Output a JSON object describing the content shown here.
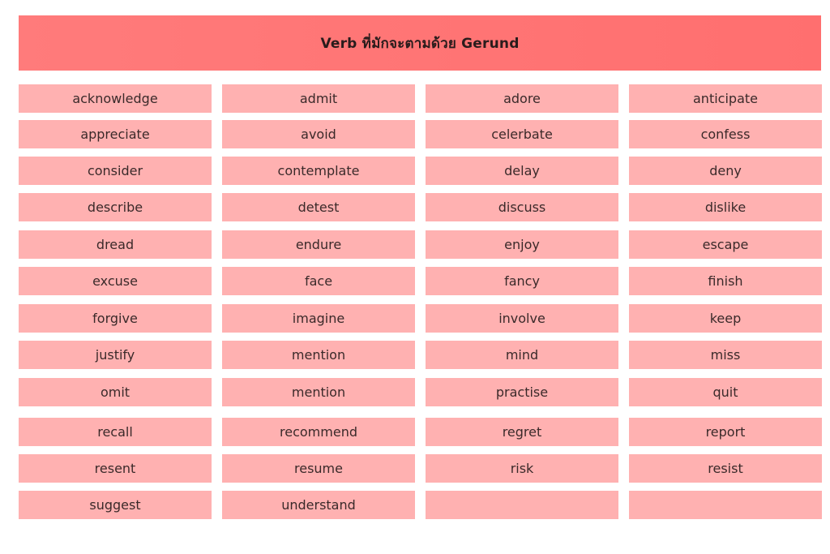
{
  "title": "Verb ที่มักจะตามด้วย Gerund",
  "rows": [
    [
      "acknowledge",
      "admit",
      "adore",
      "anticipate"
    ],
    [
      "appreciate",
      "avoid",
      "celerbate",
      "confess"
    ],
    [
      "consider",
      "contemplate",
      "delay",
      "deny"
    ],
    [
      "describe",
      "detest",
      "discuss",
      "dislike"
    ],
    [
      "dread",
      "endure",
      "enjoy",
      "escape"
    ],
    [
      "excuse",
      "face",
      "fancy",
      "finish"
    ],
    [
      "forgive",
      "imagine",
      "involve",
      "keep"
    ],
    [
      "justify",
      "mention",
      "mind",
      "miss"
    ],
    [
      "omit",
      "mention",
      "practise",
      "quit"
    ],
    [
      "recall",
      "recommend",
      "regret",
      "report"
    ],
    [
      "resent",
      "resume",
      "risk",
      "resist"
    ],
    [
      "suggest",
      "understand",
      "",
      ""
    ]
  ],
  "colors": {
    "header": "#ff7070",
    "cell": "#ffb1b1",
    "text": "#3a2a2a"
  }
}
